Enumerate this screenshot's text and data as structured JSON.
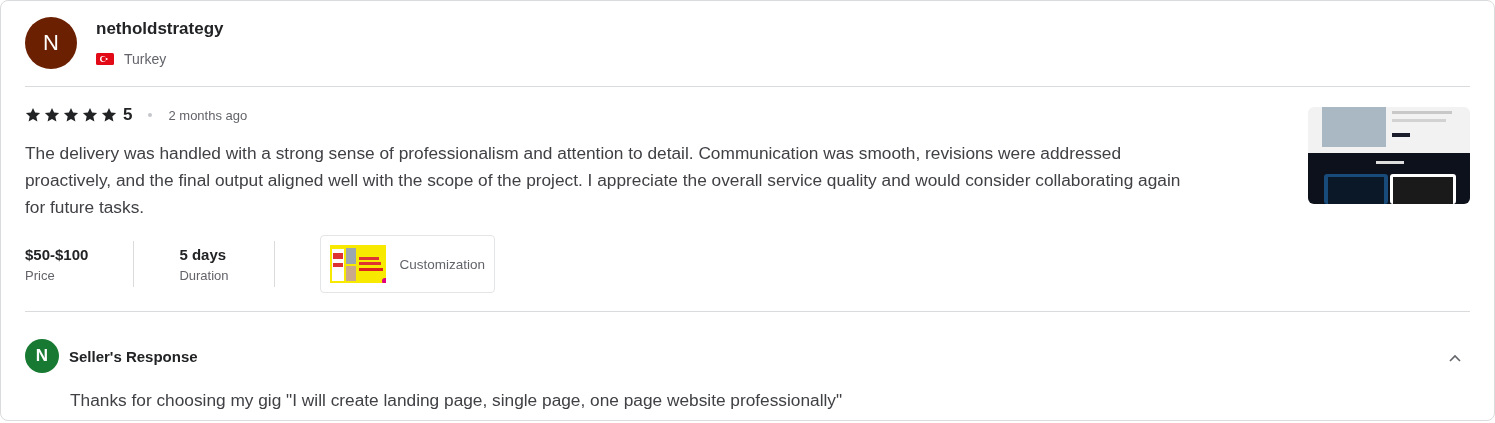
{
  "reviewer": {
    "initial": "N",
    "name": "netholdstrategy",
    "country": "Turkey"
  },
  "review": {
    "stars": 5,
    "rating": "5",
    "time": "2 months ago",
    "text": "The delivery was handled with a strong sense of professionalism and attention to detail. Communication was smooth, revisions were addressed proactively, and the final output aligned well with the scope of the project. I appreciate the overall service quality and would consider collaborating again for future tasks."
  },
  "stats": [
    {
      "value": "$50-$100",
      "label": "Price"
    },
    {
      "value": "5 days",
      "label": "Duration"
    }
  ],
  "gig": {
    "label": "Customization"
  },
  "response": {
    "initial": "N",
    "title": "Seller's Response",
    "expanded": true,
    "text": "Thanks for choosing my gig \"I will create landing page, single page, one page website professionally\""
  }
}
